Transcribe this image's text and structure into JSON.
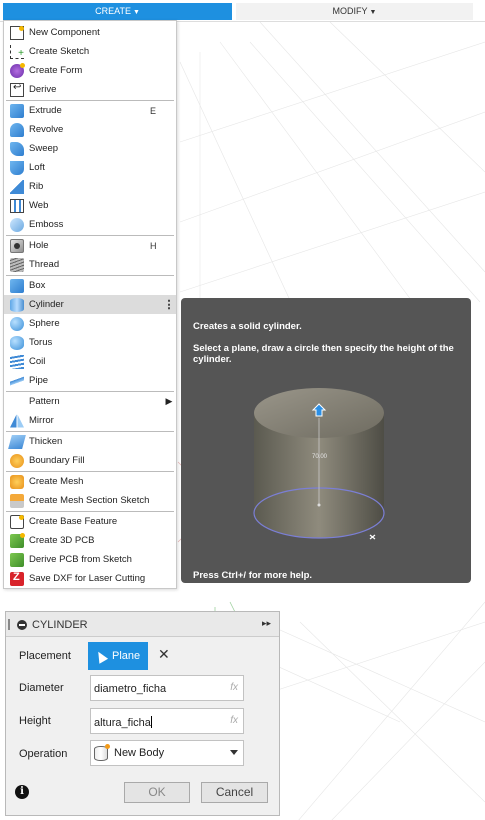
{
  "toolbar": {
    "create_label": "CREATE",
    "modify_label": "MODIFY"
  },
  "menu": {
    "items": [
      {
        "label": "New Component",
        "icon": "new-component-icon",
        "shortcut": ""
      },
      {
        "label": "Create Sketch",
        "icon": "create-sketch-icon",
        "shortcut": ""
      },
      {
        "label": "Create Form",
        "icon": "create-form-icon",
        "shortcut": ""
      },
      {
        "label": "Derive",
        "icon": "derive-icon",
        "shortcut": ""
      },
      {
        "label": "Extrude",
        "icon": "extrude-icon",
        "shortcut": "E"
      },
      {
        "label": "Revolve",
        "icon": "revolve-icon",
        "shortcut": ""
      },
      {
        "label": "Sweep",
        "icon": "sweep-icon",
        "shortcut": ""
      },
      {
        "label": "Loft",
        "icon": "loft-icon",
        "shortcut": ""
      },
      {
        "label": "Rib",
        "icon": "rib-icon",
        "shortcut": ""
      },
      {
        "label": "Web",
        "icon": "web-icon",
        "shortcut": ""
      },
      {
        "label": "Emboss",
        "icon": "emboss-icon",
        "shortcut": ""
      },
      {
        "label": "Hole",
        "icon": "hole-icon",
        "shortcut": "H"
      },
      {
        "label": "Thread",
        "icon": "thread-icon",
        "shortcut": ""
      },
      {
        "label": "Box",
        "icon": "box-icon",
        "shortcut": ""
      },
      {
        "label": "Cylinder",
        "icon": "cylinder-icon",
        "shortcut": ""
      },
      {
        "label": "Sphere",
        "icon": "sphere-icon",
        "shortcut": ""
      },
      {
        "label": "Torus",
        "icon": "torus-icon",
        "shortcut": ""
      },
      {
        "label": "Coil",
        "icon": "coil-icon",
        "shortcut": ""
      },
      {
        "label": "Pipe",
        "icon": "pipe-icon",
        "shortcut": ""
      },
      {
        "label": "Pattern",
        "icon": "",
        "shortcut": ""
      },
      {
        "label": "Mirror",
        "icon": "mirror-icon",
        "shortcut": ""
      },
      {
        "label": "Thicken",
        "icon": "thicken-icon",
        "shortcut": ""
      },
      {
        "label": "Boundary Fill",
        "icon": "boundary-fill-icon",
        "shortcut": ""
      },
      {
        "label": "Create Mesh",
        "icon": "create-mesh-icon",
        "shortcut": ""
      },
      {
        "label": "Create Mesh Section Sketch",
        "icon": "mesh-section-sketch-icon",
        "shortcut": ""
      },
      {
        "label": "Create Base Feature",
        "icon": "base-feature-icon",
        "shortcut": ""
      },
      {
        "label": "Create 3D PCB",
        "icon": "3d-pcb-icon",
        "shortcut": ""
      },
      {
        "label": "Derive PCB from Sketch",
        "icon": "derive-pcb-icon",
        "shortcut": ""
      },
      {
        "label": "Save DXF for Laser Cutting",
        "icon": "save-dxf-icon",
        "shortcut": ""
      }
    ],
    "active_item": "Cylinder",
    "more_glyph": "⋮",
    "submenu_glyph": "▶"
  },
  "tooltip": {
    "title": "Creates a solid cylinder.",
    "description": "Select a plane, draw a circle then specify the height of the cylinder.",
    "dimension_label": "70.00",
    "help": "Press Ctrl+/ for more help."
  },
  "dialog": {
    "title": "CYLINDER",
    "expand_glyph": "▸▸",
    "placement_label": "Placement",
    "placement_button": "Plane",
    "clear_glyph": "✕",
    "diameter_label": "Diameter",
    "diameter_value": "diametro_ficha",
    "height_label": "Height",
    "height_value": "altura_ficha",
    "fx_label": "fx",
    "operation_label": "Operation",
    "operation_value": "New Body",
    "info_glyph": "i",
    "ok_label": "OK",
    "cancel_label": "Cancel"
  },
  "colors": {
    "accent": "#1e90e0",
    "tooltip_bg": "#555555",
    "active_row": "#dcdcdc"
  }
}
